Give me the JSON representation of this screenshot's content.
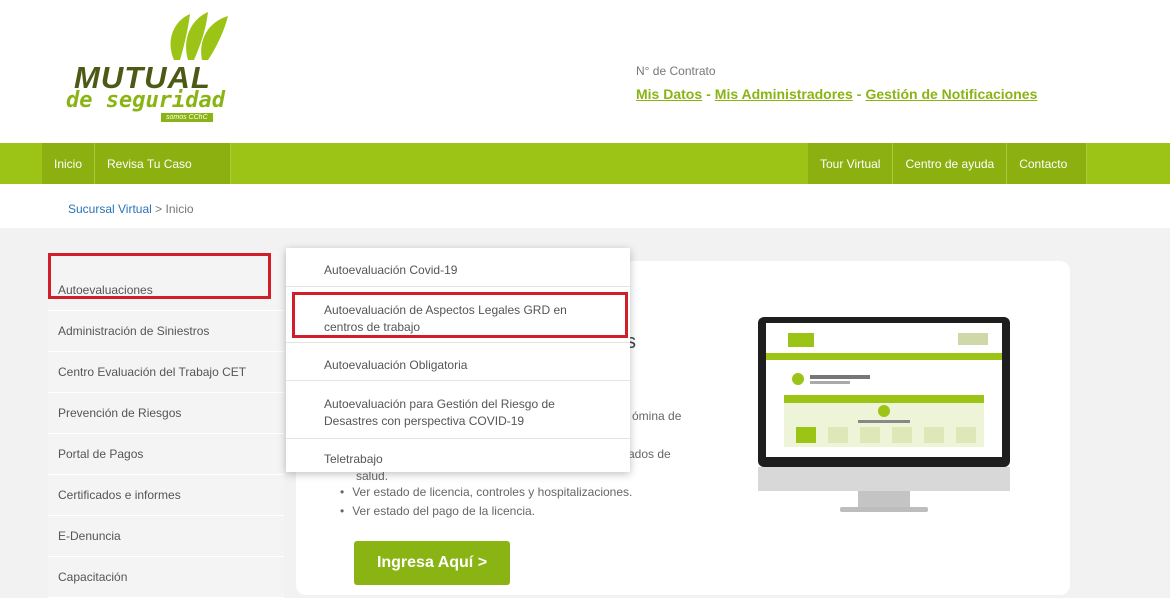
{
  "logo": {
    "word1": "MUTUAL",
    "word2": "de seguridad",
    "tagline": "somos CChC"
  },
  "header": {
    "contract_label": "N° de Contrato",
    "links": [
      "Mis Datos",
      "Mis Administradores",
      "Gestión de Notificaciones"
    ],
    "separator": "-"
  },
  "nav": {
    "left": [
      "Inicio",
      "Revisa Tu Caso"
    ],
    "right": [
      "Tour Virtual",
      "Centro de ayuda",
      "Contacto"
    ]
  },
  "breadcrumb": {
    "home": "Sucursal Virtual",
    "current": "> Inicio"
  },
  "sidemenu": [
    "Autoevaluaciones",
    "Administración de Siniestros",
    "Centro Evaluación del Trabajo CET",
    "Prevención de Riesgos",
    "Portal de Pagos",
    "Certificados e informes",
    "E-Denuncia",
    "Capacitación"
  ],
  "dropdown": [
    "Autoevaluación Covid-19",
    "Autoevaluación de Aspectos Legales GRD en centros de trabajo",
    "Autoevaluación Obligatoria",
    "Autoevaluación para Gestión del Riesgo de Desastres con perspectiva COVID-19",
    "Teletrabajo"
  ],
  "card": {
    "title_fragment": "s",
    "text_fragment_1": "ómina de",
    "text_fragment_2": "tificados de",
    "text_fragment_3": "salud.",
    "bullets": [
      "Ver estado de licencia, controles y hospitalizaciones.",
      "Ver estado del pago de la licencia."
    ],
    "cta": "Ingresa Aquí >"
  },
  "colors": {
    "brand_green": "#9cc416",
    "dark_green": "#8bb00f",
    "highlight_red": "#d11f2a",
    "link_blue": "#2b73b8"
  }
}
